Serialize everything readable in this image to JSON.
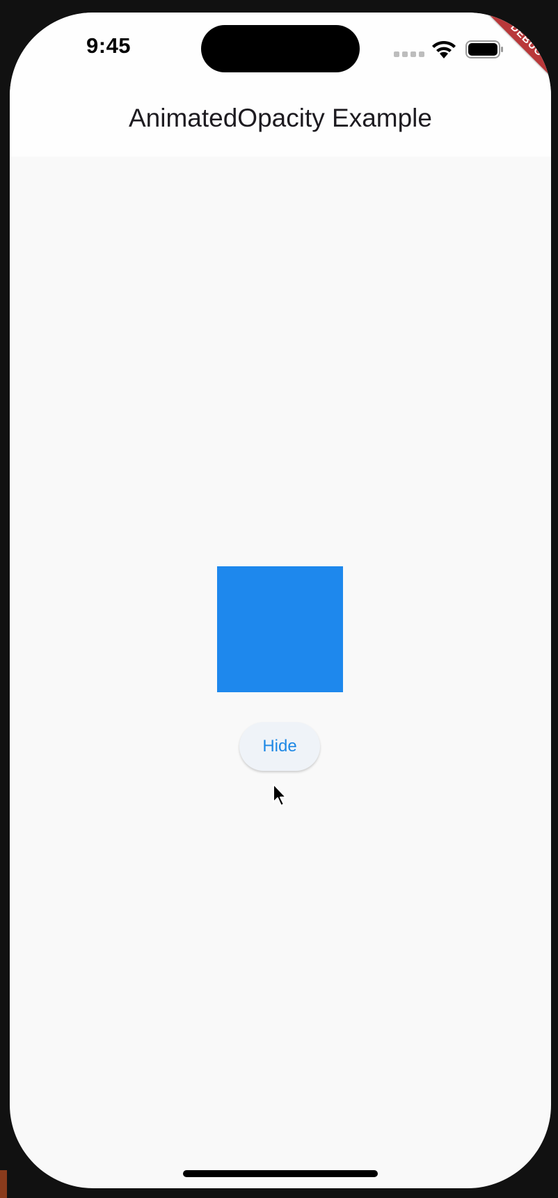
{
  "status_bar": {
    "time": "9:45",
    "icons": [
      "cellular-signal-icon",
      "wifi-icon",
      "battery-icon"
    ]
  },
  "debug_banner": {
    "label": "DEBUG",
    "color": "#b9383a"
  },
  "app_bar": {
    "title": "AnimatedOpacity Example"
  },
  "content": {
    "box": {
      "color": "#1e88ed",
      "opacity": 1.0
    },
    "toggle_button": {
      "label": "Hide"
    }
  },
  "colors": {
    "accent": "#1e88e5",
    "background": "#f9f9f9",
    "app_bar_background": "#fefefe"
  }
}
